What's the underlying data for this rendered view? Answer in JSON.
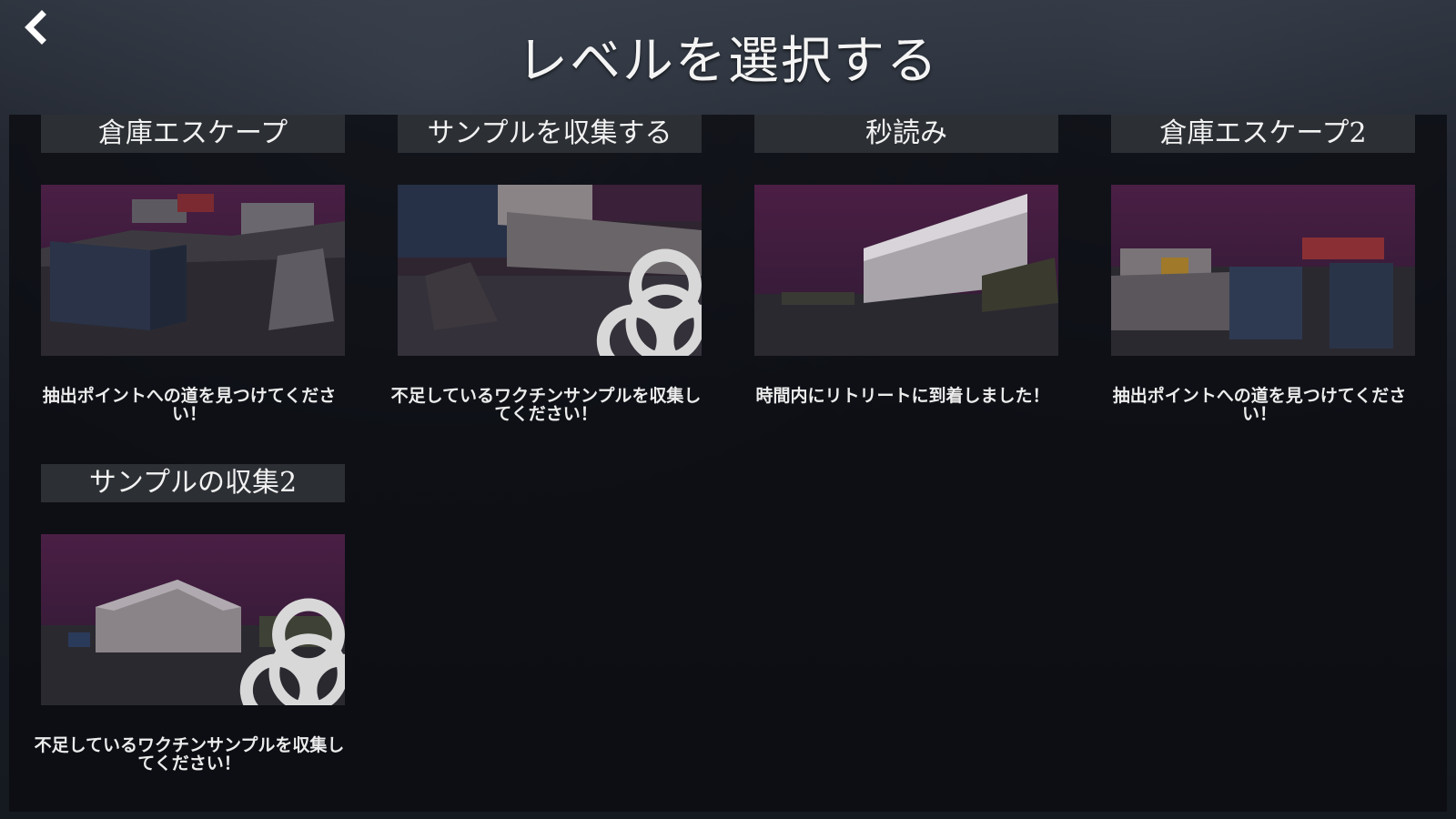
{
  "header": {
    "title": "レベルを選択する",
    "back_icon": "chevron-left-icon"
  },
  "levels": [
    {
      "title": "倉庫エスケープ",
      "description": "抽出ポイントへの道を見つけてください！",
      "locked": false
    },
    {
      "title": "サンプルを収集する",
      "description": "不足しているワクチンサンプルを収集してください！",
      "locked": true
    },
    {
      "title": "秒読み",
      "description": "時間内にリトリートに到着しました！",
      "locked": false
    },
    {
      "title": "倉庫エスケープ2",
      "description": "抽出ポイントへの道を見つけてください！",
      "locked": false
    },
    {
      "title": "サンプルの収集2",
      "description": "不足しているワクチンサンプルを収集してください！",
      "locked": true
    }
  ],
  "lock_icon": "biohazard-icon",
  "colors": {
    "panel": "#0a0c11",
    "title_bar": "#2c2f34",
    "sky": "#3a1d3a",
    "ground": "#2b2930"
  }
}
